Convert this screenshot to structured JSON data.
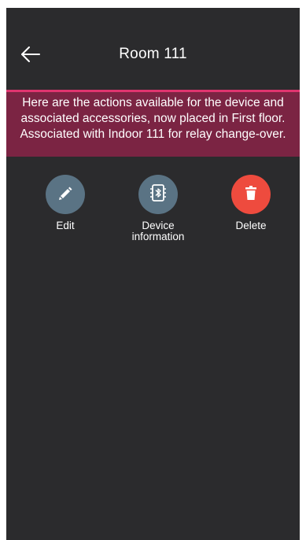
{
  "header": {
    "title": "Room 111",
    "back_icon": "arrow-left-icon"
  },
  "banner": {
    "text": "Here are the actions available for the device and associated accessories, now placed in First floor. Associated with Indoor 111 for relay change-over."
  },
  "actions": [
    {
      "label": "Edit",
      "icon": "pencil-icon",
      "color": "#5a7384"
    },
    {
      "label": "Device\ninformation",
      "icon": "bluetooth-chip-icon",
      "color": "#5a7384"
    },
    {
      "label": "Delete",
      "icon": "trash-icon",
      "color": "#ee4b3e"
    }
  ],
  "colors": {
    "background": "#2b2b2d",
    "accent": "#e0356f",
    "banner": "#7b2443"
  }
}
